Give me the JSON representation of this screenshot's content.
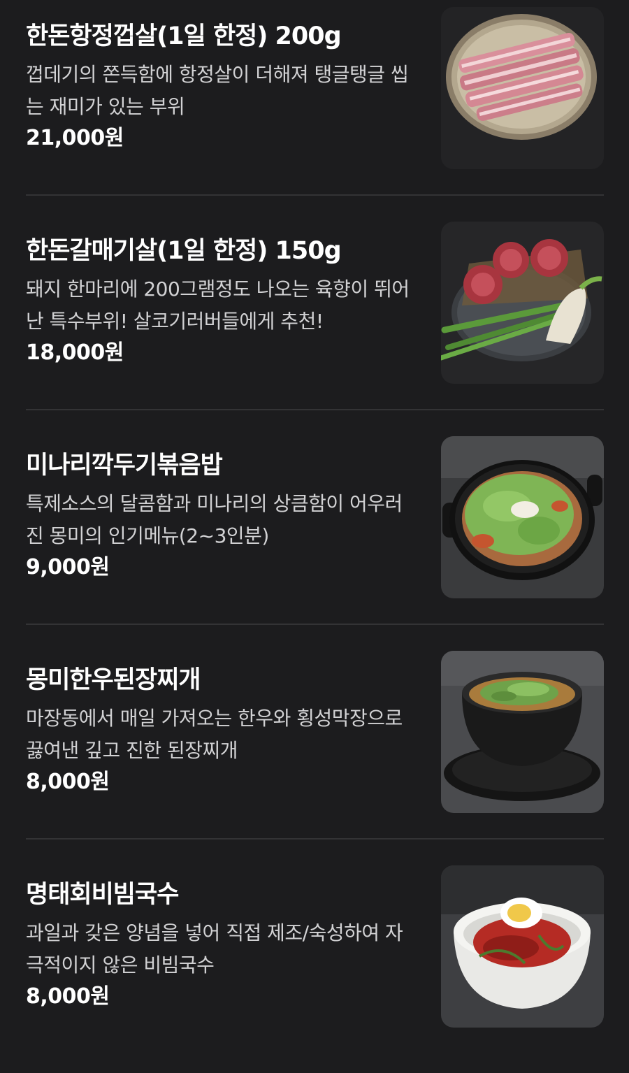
{
  "menu": {
    "items": [
      {
        "name": "한돈항정껍살(1일 한정) 200g",
        "description": "껍데기의 쫀득함에 항정살이 더해져 탱글탱글 씹는 재미가 있는 부위",
        "price": "21,000원",
        "image": "pork-jowl-skin-photo"
      },
      {
        "name": "한돈갈매기살(1일 한정) 150g",
        "description": "돼지 한마리에 200그램정도 나오는 육향이 뛰어난 특수부위! 살코기러버들에게 추천!",
        "price": "18,000원",
        "image": "pork-skirt-meat-photo"
      },
      {
        "name": "미나리깍두기볶음밥",
        "description": "특제소스의 달콤함과 미나리의 상큼함이 어우러진 몽미의 인기메뉴(2~3인분)",
        "price": "9,000원",
        "image": "fried-rice-photo"
      },
      {
        "name": "몽미한우된장찌개",
        "description": "마장동에서 매일 가져오는 한우와 횡성막장으로 끓여낸 깊고 진한 된장찌개",
        "price": "8,000원",
        "image": "doenjang-stew-photo"
      },
      {
        "name": "명태회비빔국수",
        "description": "과일과 갖은 양념을 넣어 직접 제조/숙성하여 자극적이지 않은 비빔국수",
        "price": "8,000원",
        "image": "spicy-noodles-photo"
      }
    ]
  },
  "colors": {
    "background": "#1c1c1e",
    "title": "#ffffff",
    "description": "#d2d2d4",
    "divider": "#333335"
  }
}
